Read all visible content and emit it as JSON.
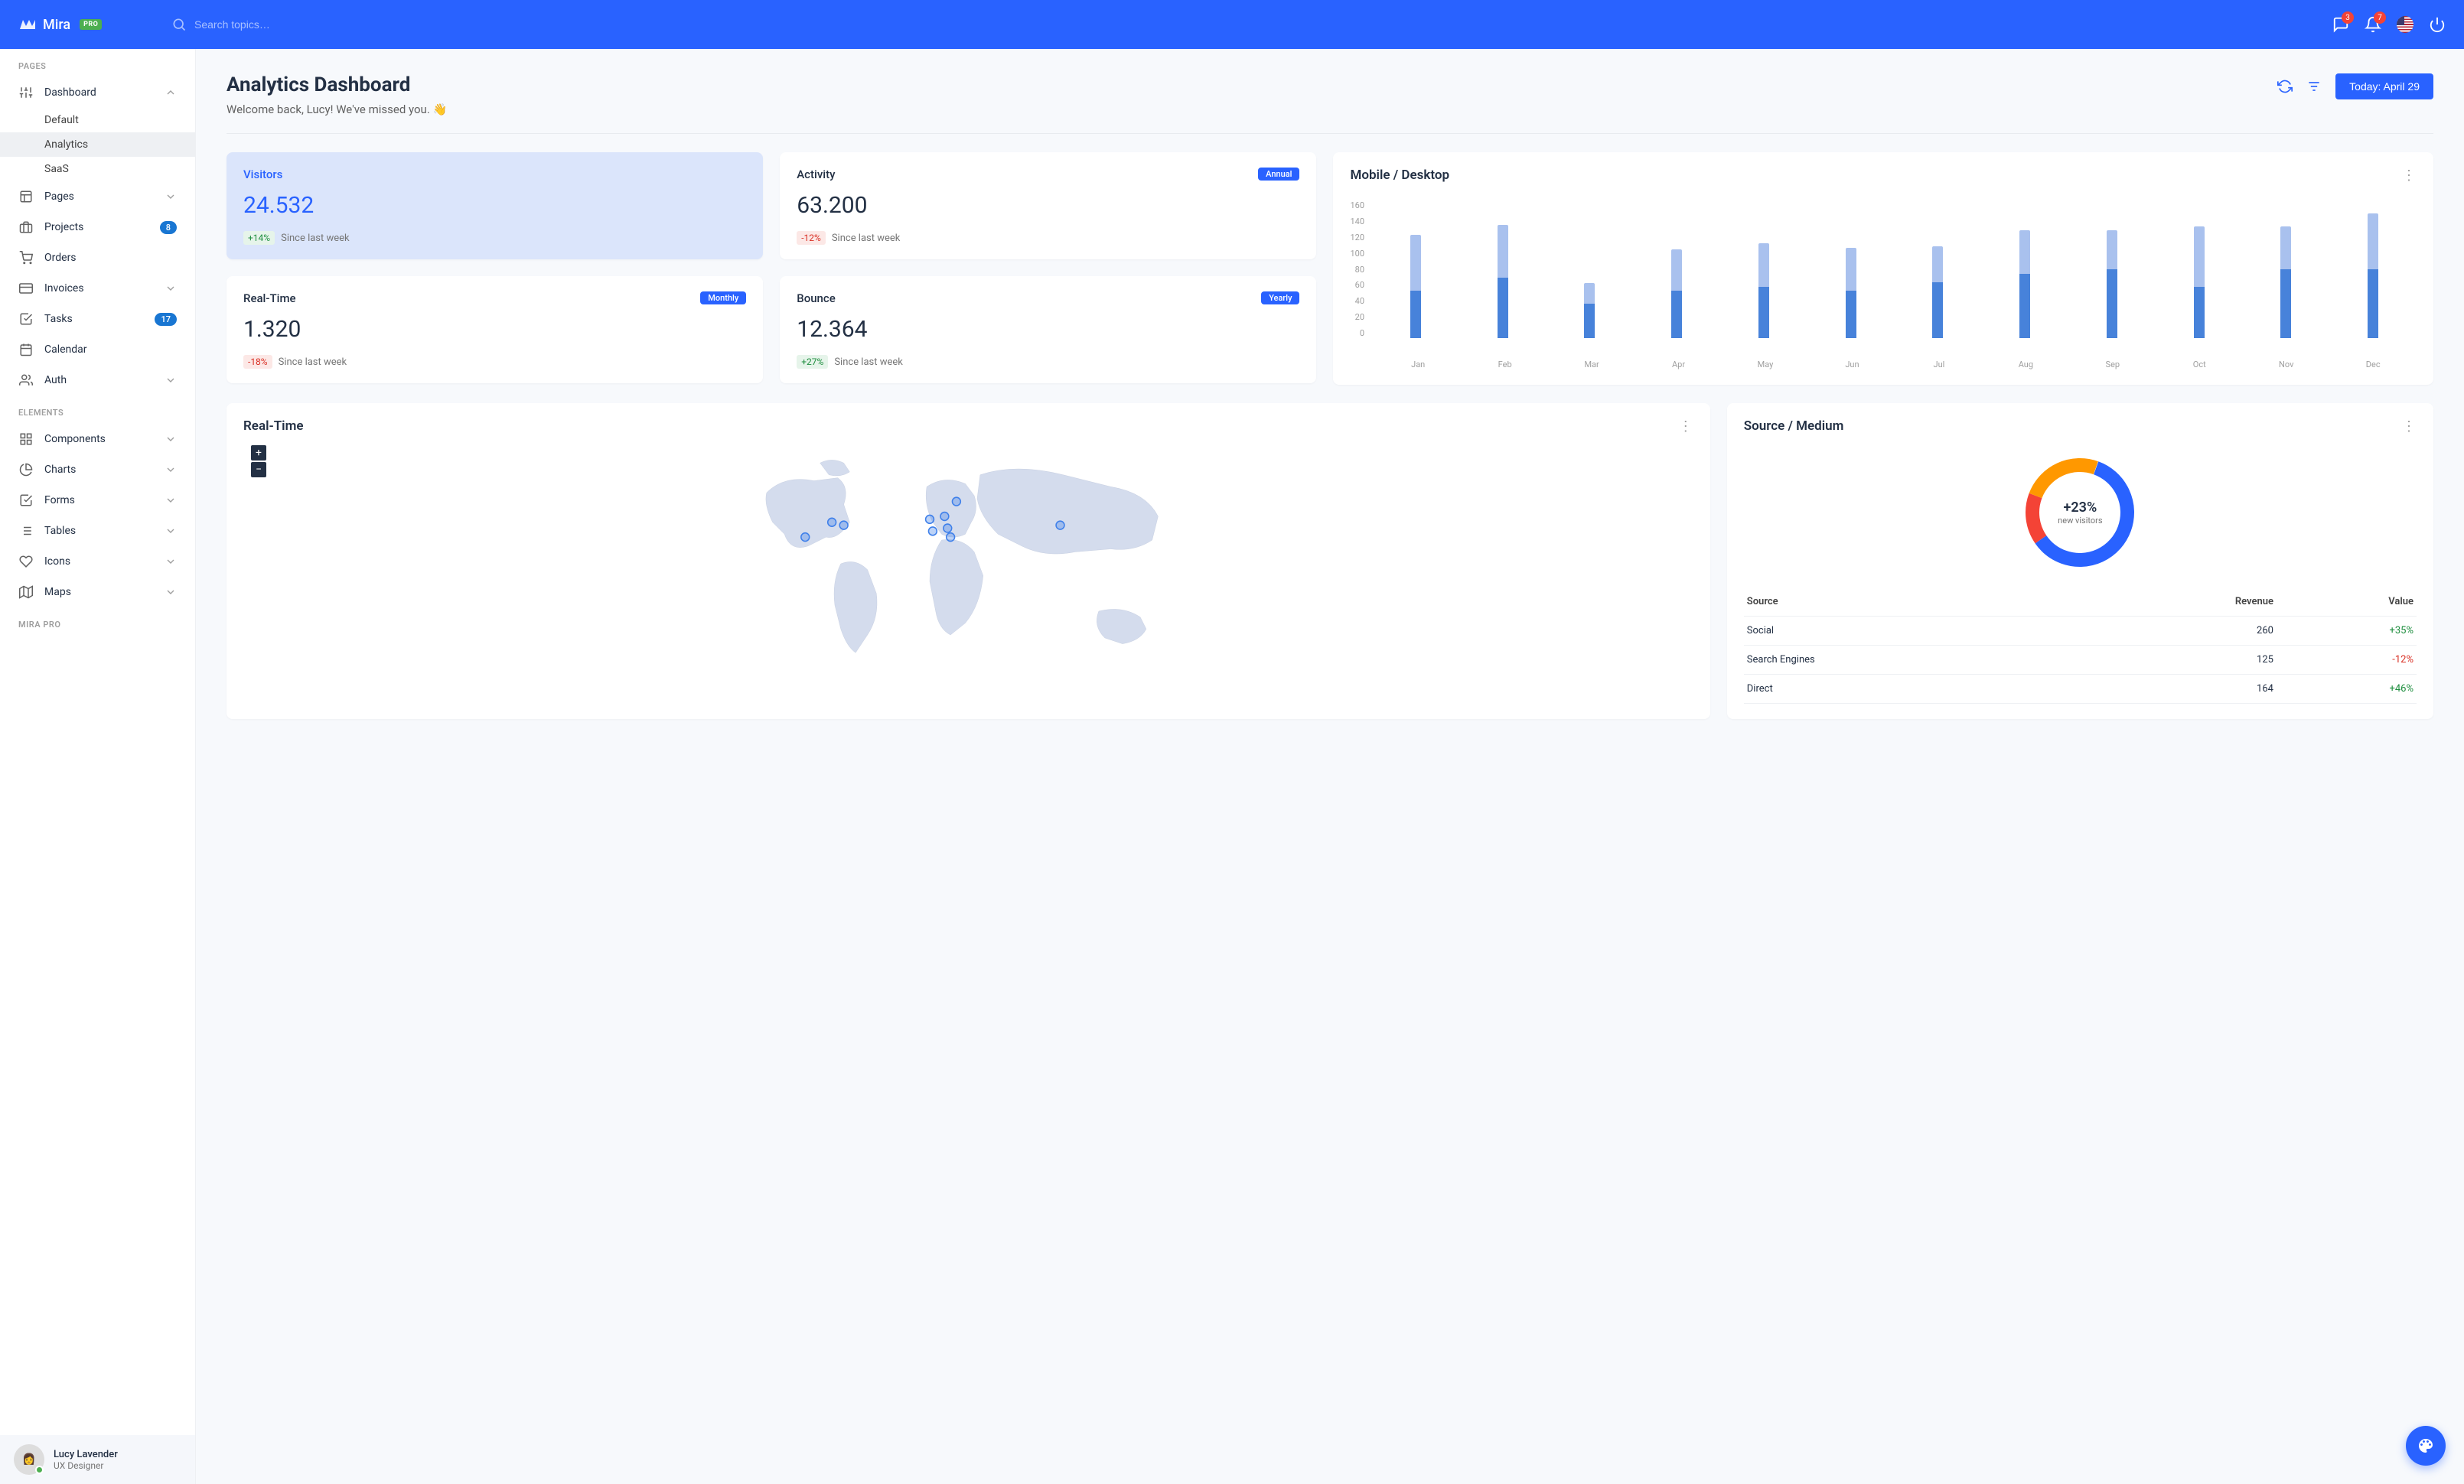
{
  "brand": {
    "name": "Mira",
    "badge": "PRO"
  },
  "search": {
    "placeholder": "Search topics…"
  },
  "topbar": {
    "messages_count": "3",
    "alerts_count": "7"
  },
  "sidebar": {
    "section_pages": "PAGES",
    "section_elements": "ELEMENTS",
    "section_pro": "MIRA PRO",
    "items": {
      "dashboard": "Dashboard",
      "dashboard_sub": {
        "default": "Default",
        "analytics": "Analytics",
        "saas": "SaaS"
      },
      "pages": "Pages",
      "projects": "Projects",
      "projects_count": "8",
      "orders": "Orders",
      "invoices": "Invoices",
      "tasks": "Tasks",
      "tasks_count": "17",
      "calendar": "Calendar",
      "auth": "Auth",
      "components": "Components",
      "charts": "Charts",
      "forms": "Forms",
      "tables": "Tables",
      "icons": "Icons",
      "maps": "Maps"
    }
  },
  "user": {
    "name": "Lucy Lavender",
    "role": "UX Designer"
  },
  "page": {
    "title": "Analytics Dashboard",
    "subtitle": "Welcome back, Lucy! We've missed you. 👋",
    "date_button": "Today: April 29"
  },
  "stats": {
    "visitors": {
      "title": "Visitors",
      "value": "24.532",
      "delta": "+14%",
      "suffix": "Since last week",
      "dir": "pos"
    },
    "activity": {
      "title": "Activity",
      "value": "63.200",
      "delta": "-12%",
      "suffix": "Since last week",
      "dir": "neg",
      "chip": "Annual"
    },
    "realtime": {
      "title": "Real-Time",
      "value": "1.320",
      "delta": "-18%",
      "suffix": "Since last week",
      "dir": "neg",
      "chip": "Monthly"
    },
    "bounce": {
      "title": "Bounce",
      "value": "12.364",
      "delta": "+27%",
      "suffix": "Since last week",
      "dir": "pos",
      "chip": "Yearly"
    }
  },
  "chart_data": {
    "type": "bar",
    "title": "Mobile / Desktop",
    "categories": [
      "Jan",
      "Feb",
      "Mar",
      "Apr",
      "May",
      "Jun",
      "Jul",
      "Aug",
      "Sep",
      "Oct",
      "Nov",
      "Dec"
    ],
    "series": [
      {
        "name": "Mobile",
        "values": [
          55,
          70,
          40,
          55,
          60,
          55,
          65,
          75,
          80,
          60,
          80,
          80
        ]
      },
      {
        "name": "Desktop",
        "values": [
          65,
          62,
          24,
          48,
          50,
          50,
          42,
          50,
          45,
          70,
          50,
          65
        ]
      }
    ],
    "ylabel": "",
    "ylim": [
      0,
      160
    ],
    "yticks": [
      0,
      20,
      40,
      60,
      80,
      100,
      120,
      140,
      160
    ]
  },
  "realtime_map": {
    "title": "Real-Time"
  },
  "source": {
    "title": "Source / Medium",
    "donut": {
      "pct": "+23%",
      "label": "new visitors"
    },
    "headers": {
      "c1": "Source",
      "c2": "Revenue",
      "c3": "Value"
    },
    "rows": [
      {
        "name": "Social",
        "revenue": "260",
        "value": "+35%",
        "dir": "pos"
      },
      {
        "name": "Search Engines",
        "revenue": "125",
        "value": "-12%",
        "dir": "neg"
      },
      {
        "name": "Direct",
        "revenue": "164",
        "value": "+46%",
        "dir": "pos"
      }
    ]
  }
}
